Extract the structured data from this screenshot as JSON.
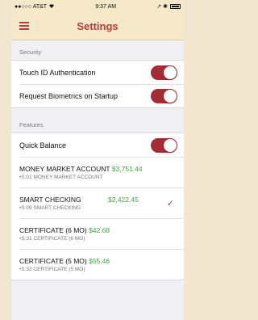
{
  "status_bar": {
    "carrier": "●●○○○ AT&T",
    "time": "9:37 AM",
    "wifi_icon": "wifi-icon",
    "right_icons": "↗ ✱"
  },
  "header": {
    "title": "Settings",
    "menu_icon": "hamburger-menu-icon"
  },
  "sections": {
    "security": {
      "title": "Security",
      "rows": [
        {
          "label": "Touch ID Authentication",
          "enabled": true
        },
        {
          "label": "Request Biometrics on Startup",
          "enabled": true
        }
      ]
    },
    "features": {
      "title": "Features",
      "quick_balance": {
        "label": "Quick Balance",
        "enabled": true
      },
      "accounts": [
        {
          "name": "MONEY MARKET ACCOUNT",
          "balance": "$3,751.44",
          "sub": "•S:01 MONEY MARKET ACCOUNT",
          "selected": false
        },
        {
          "name": "SMART CHECKING",
          "balance": "$2,422.45",
          "sub": "•S:09 SMART CHECKING",
          "selected": true
        },
        {
          "name": "CERTIFICATE (6 MO)",
          "balance": "$42.68",
          "sub": "•S:31 CERTIFICATE (6 MO)",
          "selected": false
        },
        {
          "name": "CERTIFICATE (5 MO)",
          "balance": "$55.46",
          "sub": "•S:32 CERTIFICATE (5 MO)",
          "selected": false
        }
      ],
      "checkmark": "✓"
    }
  },
  "colors": {
    "accent": "#b93a3a",
    "toggle_on": "#a62b33",
    "balance_green": "#4aa34a",
    "bar_bg": "#f6e9c9"
  }
}
